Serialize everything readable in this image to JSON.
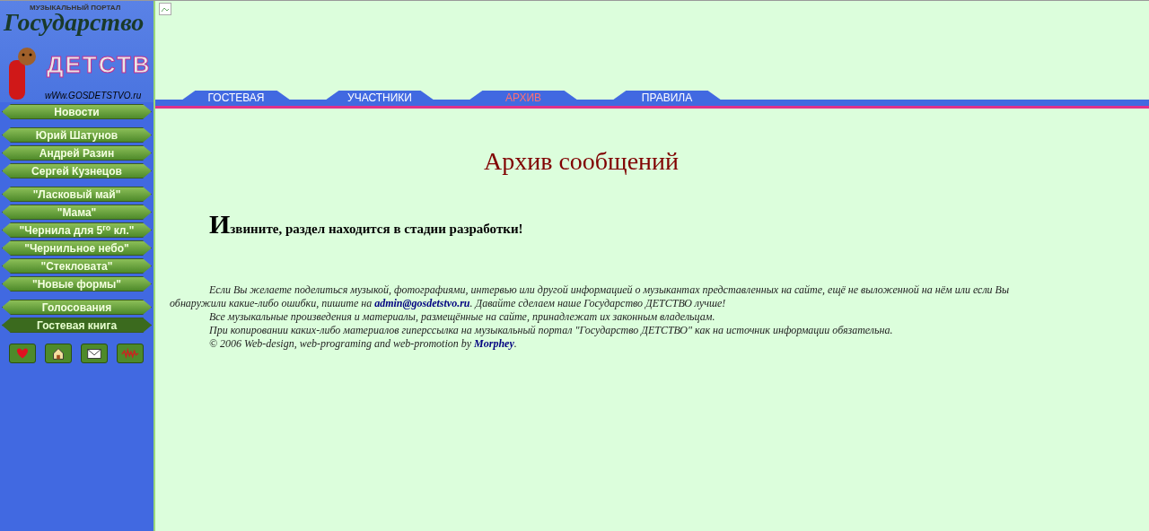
{
  "logo": {
    "caption": "МУЗЫКАЛЬНЫЙ ПОРТАЛ",
    "title": "Государство",
    "word": "ДЕТСТВ",
    "url": "wWw.GOSDETSTVO.ru"
  },
  "sidebar": {
    "groups": [
      [
        {
          "label": "Новости",
          "selected": false
        }
      ],
      [
        {
          "label": "Юрий Шатунов",
          "selected": false
        },
        {
          "label": "Андрей Разин",
          "selected": false
        },
        {
          "label": "Сергей Кузнецов",
          "selected": false
        }
      ],
      [
        {
          "label": "\"Ласковый май\"",
          "selected": false
        },
        {
          "label": "\"Мама\"",
          "selected": false
        },
        {
          "label": "\"Чернила для 5$^{го}$ кл.\"",
          "selected": false
        },
        {
          "label": "\"Чернильное небо\"",
          "selected": false
        },
        {
          "label": "\"Стекловата\"",
          "selected": false
        },
        {
          "label": "\"Новые формы\"",
          "selected": false
        }
      ],
      [
        {
          "label": "Голосования",
          "selected": false
        },
        {
          "label": "Гостевая книга",
          "selected": true
        }
      ]
    ],
    "icons": [
      {
        "kind": "heart"
      },
      {
        "kind": "home"
      },
      {
        "kind": "mail"
      },
      {
        "kind": "wave"
      }
    ]
  },
  "tabs": [
    {
      "label": "ГОСТЕВАЯ",
      "selected": false
    },
    {
      "label": "УЧАСТНИКИ",
      "selected": false
    },
    {
      "label": "АРХИВ",
      "selected": true
    },
    {
      "label": "ПРАВИЛА",
      "selected": false
    }
  ],
  "heading": "Архив сообщений",
  "notice": {
    "initial": "И",
    "rest": "звините, раздел находится в стадии разработки!"
  },
  "footer": [
    {
      "parts": [
        {
          "text": "Если Вы желаете поделиться музыкой, фотографиями, интервью или другой информацией о музыкантах представленных на сайте, ещё не выложенной на нём или если Вы обнаружили какие-либо ошибки, пишите на "
        },
        {
          "text": "admin@gosdetstvo.ru",
          "link": true
        },
        {
          "text": ". Давайте сделаем наше Государство ДЕТСТВО лучше!"
        }
      ]
    },
    {
      "parts": [
        {
          "text": "Все музыкальные произведения и материалы, размещённые на сайте, принадлежат их законным владельцам."
        }
      ]
    },
    {
      "parts": [
        {
          "text": "При копировании каких-либо материалов гиперссылка на музыкальный портал \"Государство ДЕТСТВО\" как на источник информации обязательна."
        }
      ]
    },
    {
      "parts": [
        {
          "text": "© 2006 Web-design, web-programing and web-promotion by "
        },
        {
          "text": "Morphey",
          "link": true
        },
        {
          "text": "."
        }
      ]
    }
  ]
}
